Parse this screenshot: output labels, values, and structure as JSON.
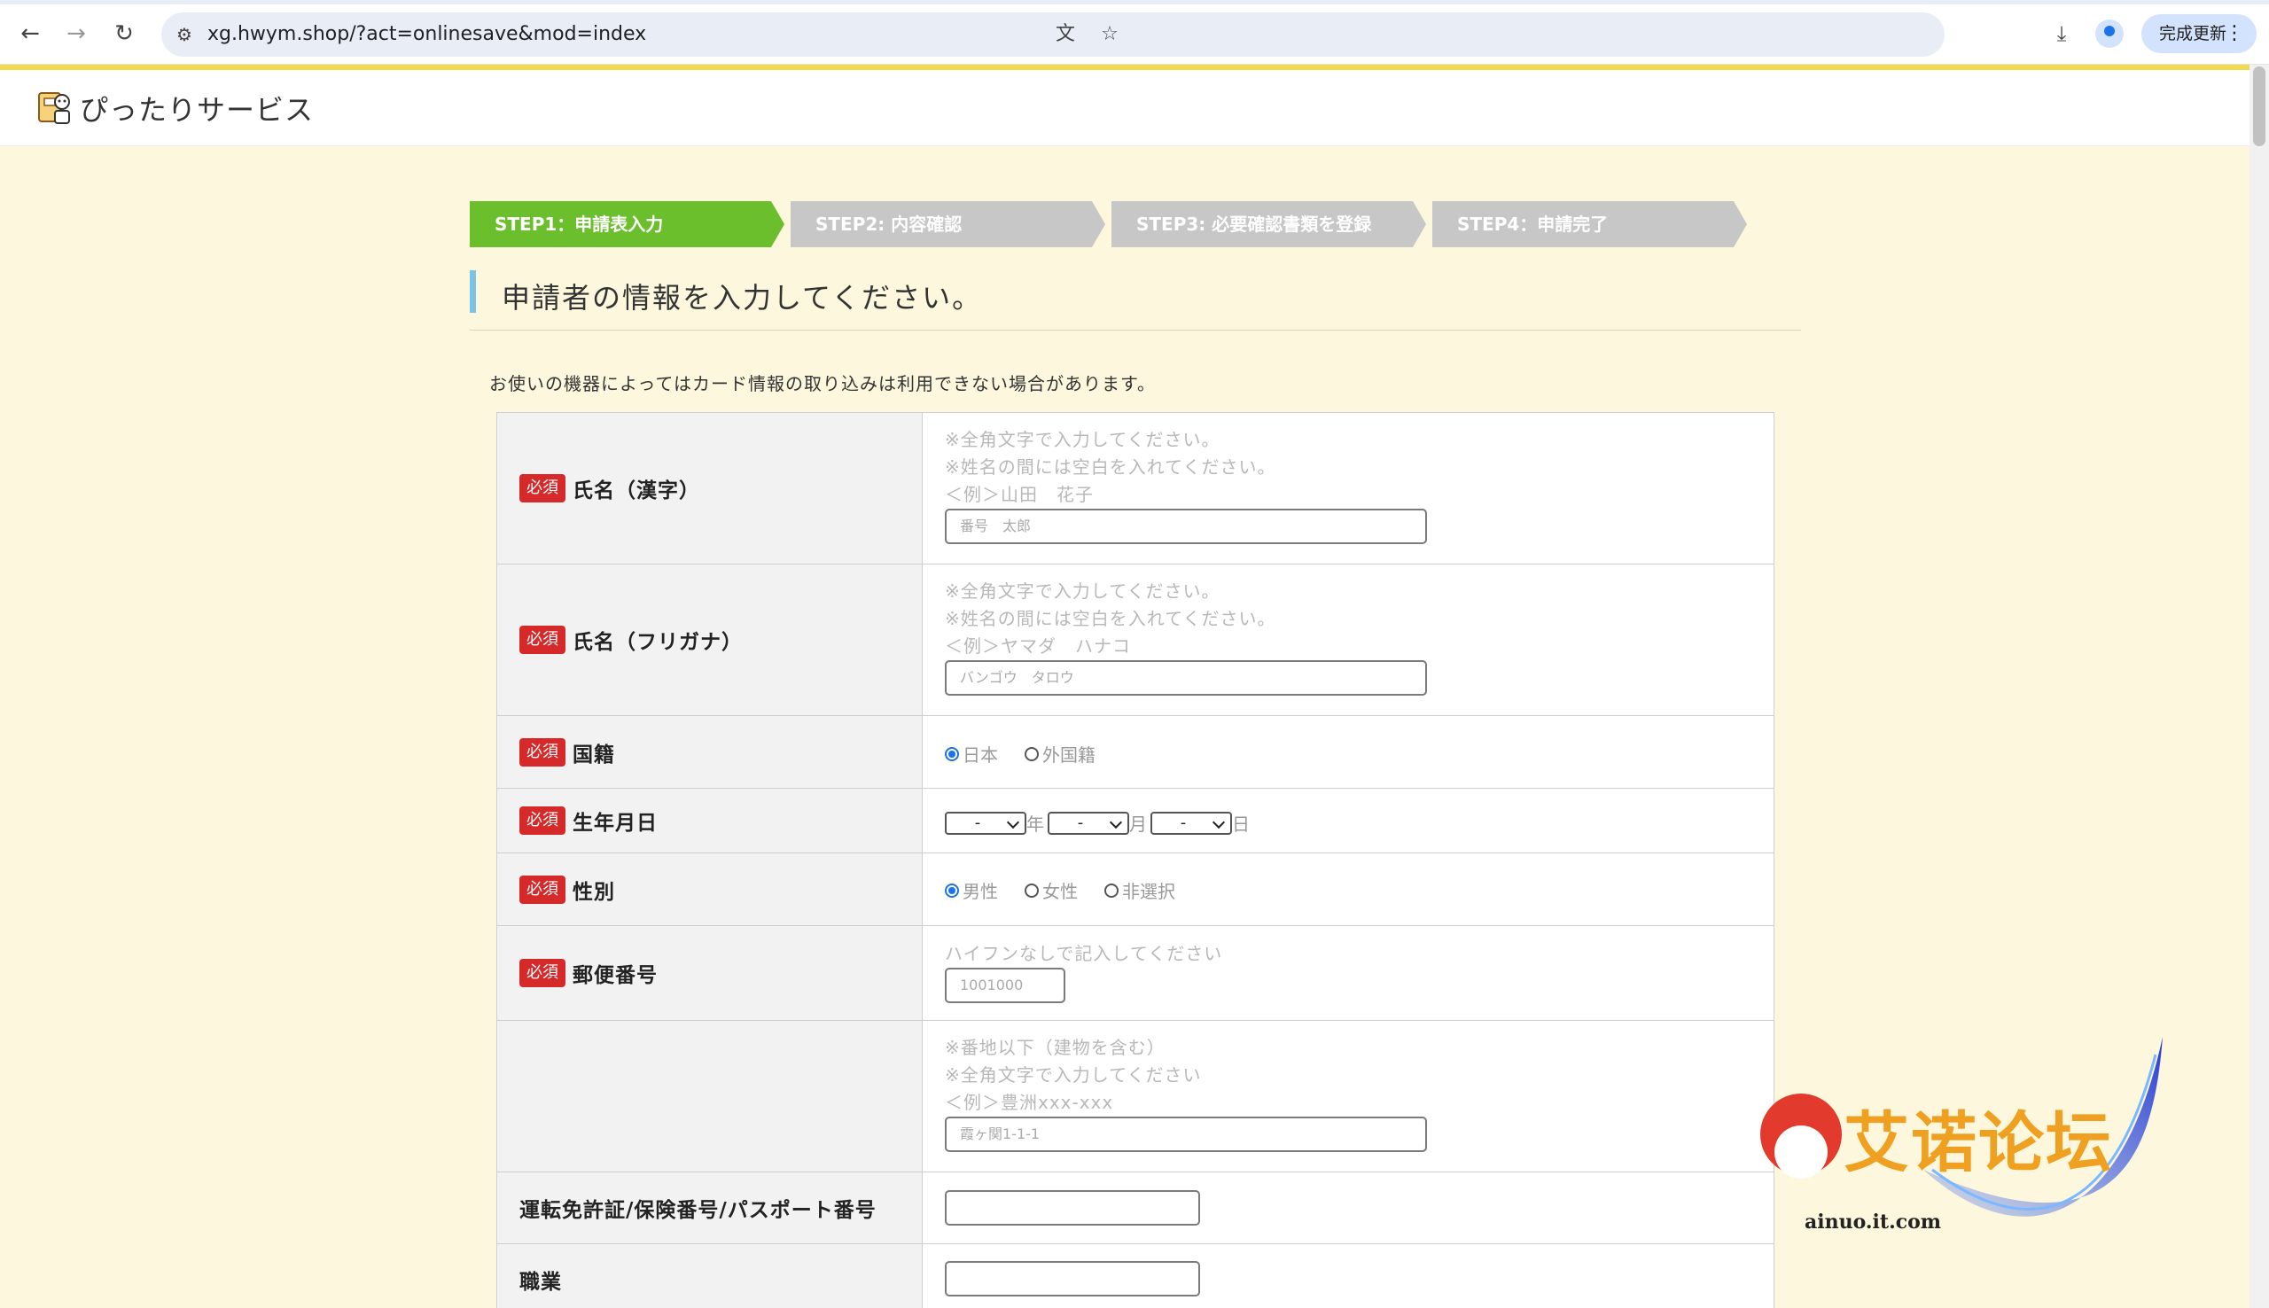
{
  "browser": {
    "url_host": "xg.hwym.shop",
    "url_path": "/?act=onlinesave&mod=index",
    "update_label": "完成更新"
  },
  "site": {
    "title": "ぴったりサービス"
  },
  "steps": [
    {
      "label": "STEP1：申請表入力",
      "active": true
    },
    {
      "label": "STEP2: 内容確認",
      "active": false
    },
    {
      "label": "STEP3: 必要確認書類を登録",
      "active": false
    },
    {
      "label": "STEP4：申請完了",
      "active": false
    }
  ],
  "section_title": "申請者の情報を入力してください。",
  "notice": "お使いの機器によってはカード情報の取り込みは利用できない場合があります。",
  "required_badge": "必須",
  "form": {
    "name_kanji": {
      "label": "氏名（漢字）",
      "hint1": "※全角文字で入力してください。",
      "hint2": "※姓名の間には空白を入れてください。",
      "hint3": "＜例＞山田　花子",
      "placeholder": "番号　太郎"
    },
    "name_kana": {
      "label": "氏名（フリガナ）",
      "hint1": "※全角文字で入力してください。",
      "hint2": "※姓名の間には空白を入れてください。",
      "hint3": "＜例＞ヤマダ　ハナコ",
      "placeholder": "バンゴウ　タロウ"
    },
    "nationality": {
      "label": "国籍",
      "options": [
        "日本",
        "外国籍"
      ],
      "selected": "日本"
    },
    "birthdate": {
      "label": "生年月日",
      "year_value": "-",
      "month_value": "-",
      "day_value": "-",
      "year_unit": "年",
      "month_unit": "月",
      "day_unit": "日"
    },
    "gender": {
      "label": "性別",
      "options": [
        "男性",
        "女性",
        "非選択"
      ],
      "selected": "男性"
    },
    "postal": {
      "label": "郵便番号",
      "hint": "ハイフンなしで記入してください",
      "placeholder": "1001000"
    },
    "address": {
      "hint1": "※番地以下（建物を含む）",
      "hint2": "※全角文字で入力してください",
      "hint3": "＜例＞豊洲xxx-xxx",
      "placeholder": "霞ヶ関1-1-1"
    },
    "license": {
      "label": "運転免許証/保険番号/パスポート番号",
      "value": ""
    },
    "occupation": {
      "label": "職業",
      "value": ""
    }
  },
  "watermark": {
    "text": "艾诺论坛",
    "sub": "ainuo.it.com"
  }
}
